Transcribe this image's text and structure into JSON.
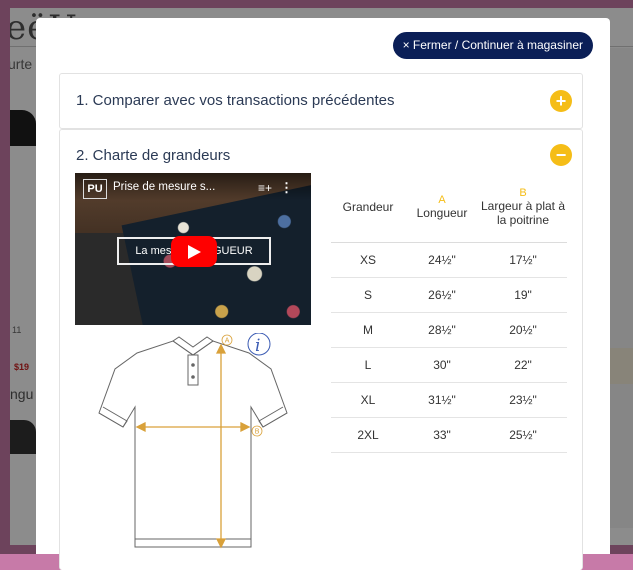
{
  "background": {
    "logo": "eëU",
    "word_top": "urte",
    "word_mid": "11",
    "price": "$19",
    "word_low": "ngu"
  },
  "modal": {
    "close_label": "× Fermer / Continuer à magasiner",
    "panels": [
      {
        "title": "1. Comparer avec vos transactions précédentes",
        "toggle": "+"
      },
      {
        "title": "2. Charte de grandeurs",
        "toggle": "−"
      }
    ],
    "video": {
      "channel_initials": "PU",
      "title": "Prise de mesure s...",
      "caption": "La mesure LONGUEUR",
      "icons": [
        "playlist-icon",
        "more-icon",
        "play-icon"
      ]
    },
    "diagram": {
      "marker_a": "A",
      "marker_b": "B",
      "info_icon": "i"
    },
    "size_table": {
      "headers": [
        {
          "letter": "",
          "label": "Grandeur"
        },
        {
          "letter": "A",
          "label": "Longueur"
        },
        {
          "letter": "B",
          "label": "Largeur à plat à la poitrine"
        }
      ],
      "rows": [
        [
          "XS",
          "24½\"",
          "17½\""
        ],
        [
          "S",
          "26½\"",
          "19\""
        ],
        [
          "M",
          "28½\"",
          "20½\""
        ],
        [
          "L",
          "30\"",
          "22\""
        ],
        [
          "XL",
          "31½\"",
          "23½\""
        ],
        [
          "2XL",
          "33\"",
          "25½\""
        ]
      ]
    }
  },
  "colors": {
    "accent": "#f5bd17",
    "button_bg": "#0b1f57",
    "title_text": "#2b3a55"
  }
}
